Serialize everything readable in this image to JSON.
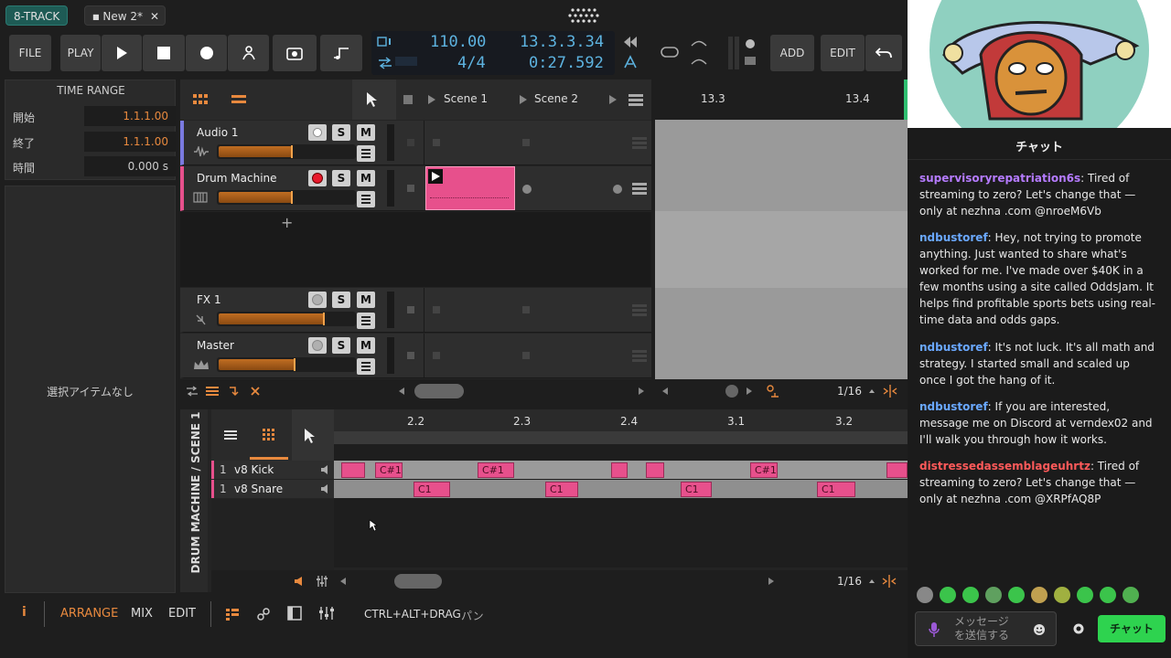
{
  "app": {
    "name": "8-TRACK",
    "doc_tab": "New 2*",
    "doc_close": "✕"
  },
  "toolbar": {
    "file": "FILE",
    "play": "PLAY",
    "add": "ADD",
    "edit": "EDIT"
  },
  "display": {
    "tempo": "110.00",
    "signature": "4/4",
    "position": "13.3.3.34",
    "time": "0:27.592"
  },
  "time_range": {
    "title": "TIME RANGE",
    "start_label": "開始",
    "start_value": "1.1.1.00",
    "end_label": "終了",
    "end_value": "1.1.1.00",
    "duration_label": "時間",
    "duration_value": "0.000 s"
  },
  "inspector": {
    "empty": "選択アイテムなし"
  },
  "scenes": {
    "scene1": "Scene 1",
    "scene2": "Scene 2"
  },
  "ruler": {
    "m1": "13.3",
    "m2": "13.4"
  },
  "tracks": [
    {
      "name": "Audio 1",
      "s": "S",
      "m": "M",
      "volume": 0.54
    },
    {
      "name": "Drum Machine",
      "s": "S",
      "m": "M",
      "volume": 0.54
    },
    {
      "name": "FX 1",
      "s": "S",
      "m": "M",
      "volume": 0.78
    },
    {
      "name": "Master",
      "s": "S",
      "m": "M",
      "volume": 0.56
    }
  ],
  "add_track": "+",
  "arranger": {
    "quantize": "1/16"
  },
  "editor": {
    "vertical_title": "DRUM MACHINE / SCENE 1",
    "ruler": [
      "2.2",
      "2.3",
      "2.4",
      "3.1",
      "3.2"
    ],
    "rows": [
      {
        "num": "1",
        "name": "v8 Kick"
      },
      {
        "num": "1",
        "name": "v8 Snare"
      }
    ],
    "quantize": "1/16",
    "note_kick": "C#1",
    "note_snare": "C1"
  },
  "statusbar": {
    "info": "i",
    "arrange": "ARRANGE",
    "mix": "MIX",
    "edit": "EDIT",
    "hint_key": "CTRL+ALT+DRAG",
    "hint_action": "パン"
  },
  "chat": {
    "title": "チャット",
    "messages": [
      {
        "user": "supervisoryrepatriation6s",
        "color": "#b57bff",
        "text": ": Tired of streaming to zero? Let's change that — only at nezhna .com @nroeM6Vb"
      },
      {
        "user": "ndbustoref",
        "color": "#6aa8ff",
        "text": ": Hey, not trying to promote anything. Just wanted to share what's worked for me. I've made over $40K in a few months using a site called OddsJam. It helps find profitable sports bets using real-time data and odds gaps."
      },
      {
        "user": "ndbustoref",
        "color": "#6aa8ff",
        "text": ": It's not luck. It's all math and strategy. I started small and scaled up once I got the hang of it."
      },
      {
        "user": "ndbustoref",
        "color": "#6aa8ff",
        "text": ": If you are interested, message me on Discord at verndex02 and I'll walk you through how it works."
      },
      {
        "user": "distressedassemblageuhrtz",
        "color": "#ff5a5a",
        "text": ": Tired of streaming to zero? Let's change that — only at nezhna .com @XRPfAQ8P"
      }
    ],
    "input_placeholder": "メッセージ\nを送信する",
    "send": "チャット"
  }
}
